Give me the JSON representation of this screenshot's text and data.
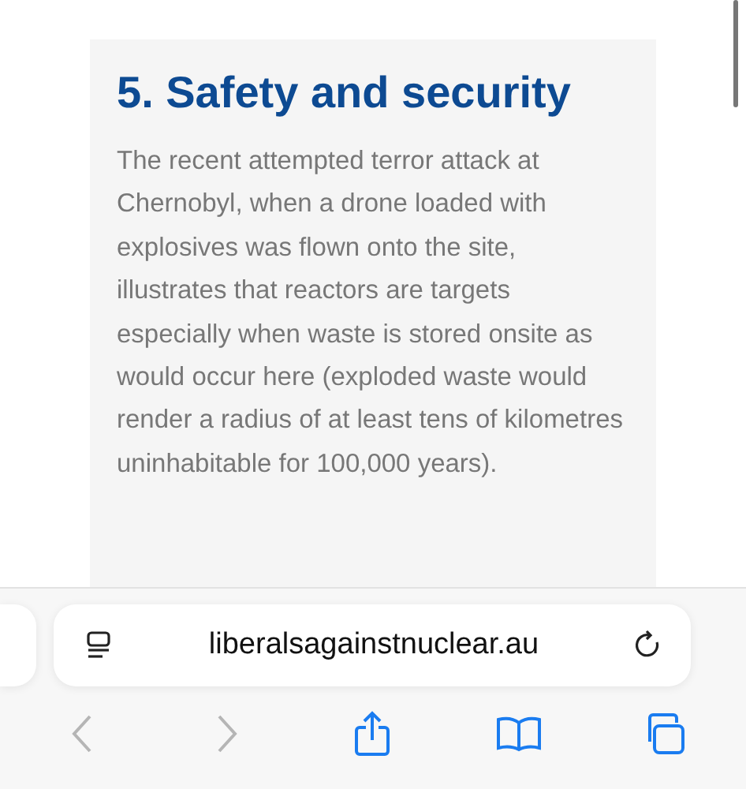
{
  "article": {
    "heading": "5. Safety and security",
    "paragraph": "The recent attempted terror attack at Chernobyl, when a drone loaded with explosives was flown onto the site, illustrates that reactors are targets especially when waste is stored onsite as would occur here (exploded waste would render a radius of at least tens of kilometres uninhabitable for 100,000 years)."
  },
  "address_bar": {
    "url": "liberalsagainstnuclear.au"
  },
  "toolbar": [
    {
      "kind": "back",
      "disabled": true
    },
    {
      "kind": "forward",
      "disabled": true
    },
    {
      "kind": "share",
      "disabled": false
    },
    {
      "kind": "bookmarks",
      "disabled": false
    },
    {
      "kind": "tabs",
      "disabled": false
    }
  ]
}
